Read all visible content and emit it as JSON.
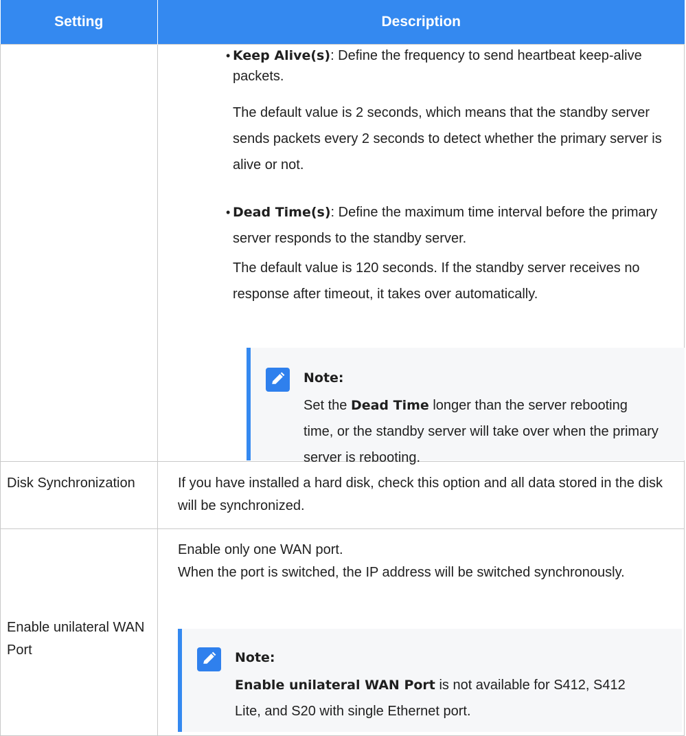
{
  "table": {
    "headers": {
      "setting": "Setting",
      "description": "Description"
    },
    "row1": {
      "bullets": [
        {
          "term": "Keep Alive(s)",
          "text": ": Define the frequency to send heartbeat keep-alive packets.",
          "detail": "The default value is 2 seconds, which means that the standby server sends packets every 2 seconds to detect whether the primary server is alive or not."
        },
        {
          "term": "Dead Time(s)",
          "text": ": Define the maximum time interval before the primary server responds to the standby server.",
          "detail": "The default value is 120 seconds. If the standby server receives no response after timeout, it takes over automatically."
        }
      ],
      "note": {
        "title": "Note:",
        "pre": "Set the ",
        "bold": "Dead Time",
        "post": " longer than the server rebooting time, or the standby server will take over when the primary server is rebooting."
      }
    },
    "row2": {
      "setting": "Disk Synchronization",
      "description": "If you have installed a hard disk, check this option and all data stored in the disk will be synchronized."
    },
    "row3": {
      "setting": "Enable unilateral WAN Port",
      "line1": "Enable only one WAN port.",
      "line2": "When the port is switched, the IP address will be switched synchronously.",
      "note": {
        "title": "Note:",
        "bold": "Enable unilateral WAN Port",
        "post": " is not available for S412, S412 Lite, and S20 with single Ethernet port."
      }
    }
  },
  "icons": {
    "note": "pencil-edit-icon"
  },
  "colors": {
    "header_bg": "#3489f0",
    "note_accent": "#3489f0",
    "note_bg": "#f6f7f9",
    "border": "#c9c9c9"
  }
}
